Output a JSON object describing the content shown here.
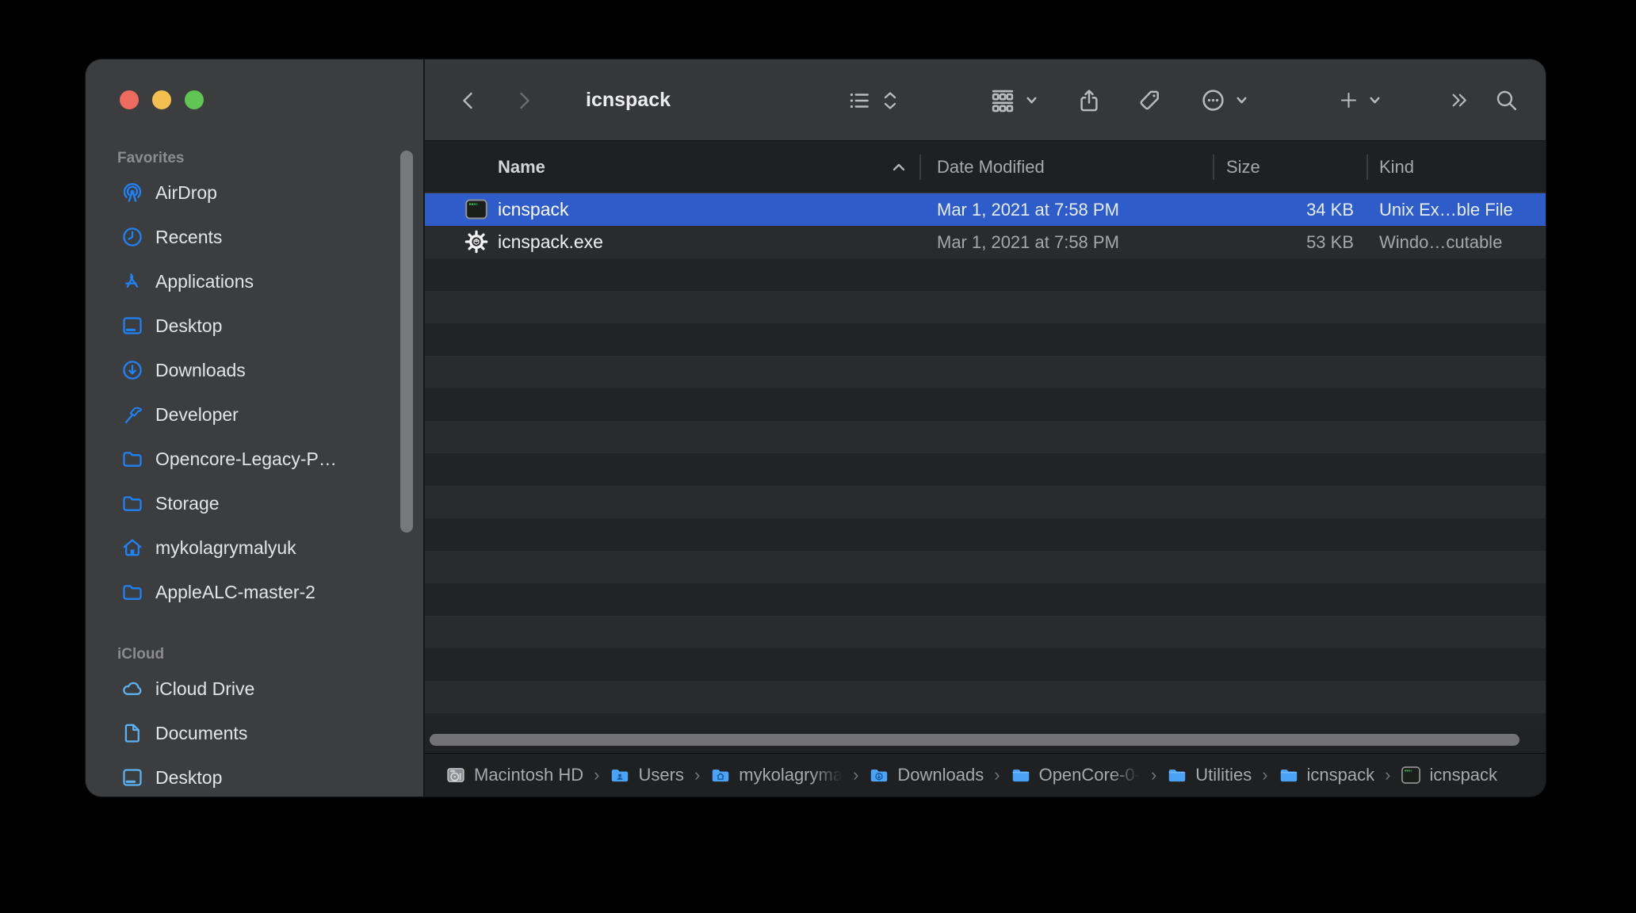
{
  "window": {
    "title": "icnspack"
  },
  "colors": {
    "selection_blue": "#2e5cc9",
    "favorites_icon_blue": "#1f82f7",
    "icloud_icon_blue": "#5bb1f2",
    "pathbar_folder_blue": "#4aa3f7",
    "traffic_red": "#ed6a5e",
    "traffic_yellow": "#f4bf4f",
    "traffic_green": "#61c554"
  },
  "toolbar": {
    "back_icon": "chevron-left-icon",
    "forward_icon": "chevron-right-icon",
    "buttons": [
      {
        "name": "view-options-button",
        "icons": [
          "list-view-icon",
          "sort-chevrons-icon"
        ]
      },
      {
        "name": "group-button",
        "icons": [
          "group-view-icon",
          "chevron-down-icon"
        ]
      },
      {
        "name": "share-button",
        "icons": [
          "share-icon"
        ]
      },
      {
        "name": "tags-button",
        "icons": [
          "tag-icon"
        ]
      },
      {
        "name": "more-actions-button",
        "icons": [
          "ellipsis-circle-icon",
          "chevron-down-icon"
        ]
      },
      {
        "name": "new-folder-button",
        "icons": [
          "plus-icon",
          "chevron-down-icon"
        ]
      },
      {
        "name": "overflow-button",
        "icons": [
          "double-chevron-icon"
        ]
      },
      {
        "name": "search-button",
        "icons": [
          "search-icon"
        ]
      }
    ]
  },
  "sidebar": {
    "sections": [
      {
        "label": "Favorites",
        "items": [
          {
            "label": "AirDrop",
            "icon": "airdrop-icon"
          },
          {
            "label": "Recents",
            "icon": "clock-icon"
          },
          {
            "label": "Applications",
            "icon": "appstore-icon"
          },
          {
            "label": "Desktop",
            "icon": "desktop-icon"
          },
          {
            "label": "Downloads",
            "icon": "download-circle-icon"
          },
          {
            "label": "Developer",
            "icon": "hammer-icon"
          },
          {
            "label": "Opencore-Legacy-P…",
            "icon": "folder-icon"
          },
          {
            "label": "Storage",
            "icon": "folder-icon"
          },
          {
            "label": "mykolagrymalyuk",
            "icon": "home-icon"
          },
          {
            "label": "AppleALC-master-2",
            "icon": "folder-icon"
          }
        ]
      },
      {
        "label": "iCloud",
        "items": [
          {
            "label": "iCloud Drive",
            "icon": "cloud-icon"
          },
          {
            "label": "Documents",
            "icon": "document-icon"
          },
          {
            "label": "Desktop",
            "icon": "desktop-icon"
          }
        ]
      }
    ]
  },
  "list": {
    "columns": [
      "Name",
      "Date Modified",
      "Size",
      "Kind"
    ],
    "sort": {
      "column": "Name",
      "direction": "ascending"
    },
    "rows": [
      {
        "name": "icnspack",
        "icon": "terminal-file-icon",
        "date": "Mar 1, 2021 at 7:58 PM",
        "size": "34 KB",
        "kind": "Unix Ex…ble File",
        "selected": true
      },
      {
        "name": "icnspack.exe",
        "icon": "gear-file-icon",
        "date": "Mar 1, 2021 at 7:58 PM",
        "size": "53 KB",
        "kind": "Windo…cutable",
        "selected": false
      }
    ]
  },
  "path_bar": {
    "items": [
      {
        "label": "Macintosh HD",
        "icon": "harddrive-icon",
        "truncated": false
      },
      {
        "label": "Users",
        "icon": "folder-users-icon",
        "truncated": false
      },
      {
        "label": "mykolagryma",
        "icon": "folder-home-icon",
        "truncated": true
      },
      {
        "label": "Downloads",
        "icon": "folder-download-icon",
        "truncated": false
      },
      {
        "label": "OpenCore-0-",
        "icon": "folder-filled-icon",
        "truncated": true
      },
      {
        "label": "Utilities",
        "icon": "folder-filled-icon",
        "truncated": false
      },
      {
        "label": "icnspack",
        "icon": "folder-filled-icon",
        "truncated": false
      },
      {
        "label": "icnspack",
        "icon": "terminal-file-icon",
        "truncated": false
      }
    ]
  }
}
